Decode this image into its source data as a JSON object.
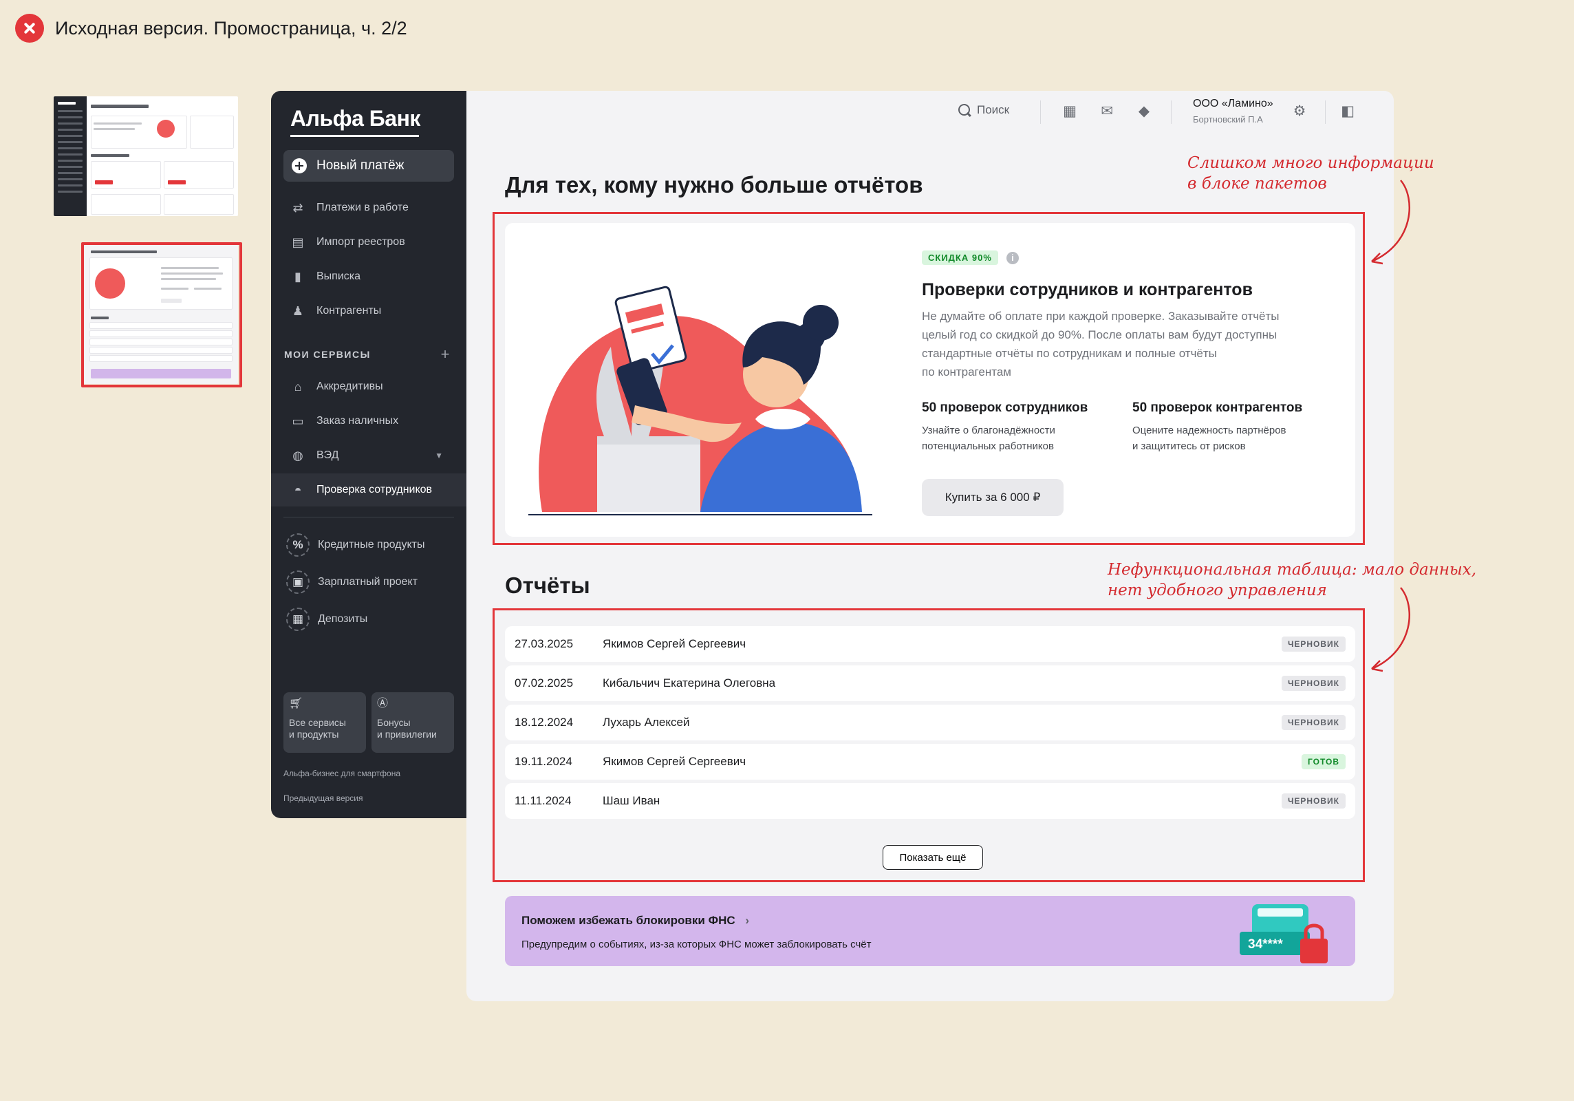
{
  "caption": "Исходная версия. Промостраница, ч. 2/2",
  "sidebar": {
    "brand": "Альфа Банк",
    "new_payment": "Новый платёж",
    "items": [
      "Платежи в работе",
      "Импорт реестров",
      "Выписка",
      "Контрагенты"
    ],
    "services_label": "МОИ СЕРВИСЫ",
    "services": [
      "Аккредитивы",
      "Заказ наличных",
      "ВЭД",
      "Проверка сотрудников"
    ],
    "promo": [
      "Кредитные продукты",
      "Зарплатный проект",
      "Депозиты"
    ],
    "tiles": [
      {
        "line1": "Все сервисы",
        "line2": "и продукты"
      },
      {
        "line1": "Бонусы",
        "line2": "и привилегии"
      }
    ],
    "mobile_link": "Альфа-бизнес для смартфона",
    "prev_version": "Предыдущая версия"
  },
  "topbar": {
    "search": "Поиск",
    "org_name": "ООО «Ламино»",
    "org_user": "Бортновский П.А"
  },
  "packs": {
    "heading": "Для тех, кому нужно больше отчётов",
    "discount": "СКИДКА 90%",
    "title": "Проверки сотрудников и контрагентов",
    "desc_lines": [
      "Не думайте об оплате при каждой проверке. Заказывайте отчёты",
      "целый год со скидкой до 90%. После оплаты вам будут доступны",
      "стандартные отчёты по сотрудникам и полные отчёты",
      "по контрагентам"
    ],
    "col1_title": "50 проверок сотрудников",
    "col1_lines": [
      "Узнайте о благонадёжности",
      "потенциальных работников"
    ],
    "col2_title": "50 проверок контрагентов",
    "col2_lines": [
      "Оцените надежность партнёров",
      "и защититесь от рисков"
    ],
    "buy": "Купить за 6 000 ₽"
  },
  "reports": {
    "heading": "Отчёты",
    "rows": [
      {
        "date": "27.03.2025",
        "name": "Якимов Сергей Сергеевич",
        "status": "ЧЕРНОВИК"
      },
      {
        "date": "07.02.2025",
        "name": "Кибальчич Екатерина Олеговна",
        "status": "ЧЕРНОВИК"
      },
      {
        "date": "18.12.2024",
        "name": "Лухарь Алексей",
        "status": "ЧЕРНОВИК"
      },
      {
        "date": "19.11.2024",
        "name": "Якимов Сергей Сергеевич",
        "status": "ГОТОВ"
      },
      {
        "date": "11.11.2024",
        "name": "Шаш Иван",
        "status": "ЧЕРНОВИК"
      }
    ],
    "more": "Показать ещё"
  },
  "fns": {
    "title": "Поможем избежать блокировки ФНС",
    "subtitle": "Предупредим о событиях, из-за которых ФНС может заблокировать счёт",
    "image_text": "34****"
  },
  "notes": {
    "packs_lines": [
      "Слишком много информации",
      "в блоке пакетов"
    ],
    "table_lines": [
      "Нефункциональная таблица: мало данных,",
      "нет удобного управления"
    ]
  },
  "colors": {
    "sidebar": "#23262d",
    "accent_red": "#e3363a",
    "ready": "#128a2a",
    "banner": "#d3b6ec"
  }
}
